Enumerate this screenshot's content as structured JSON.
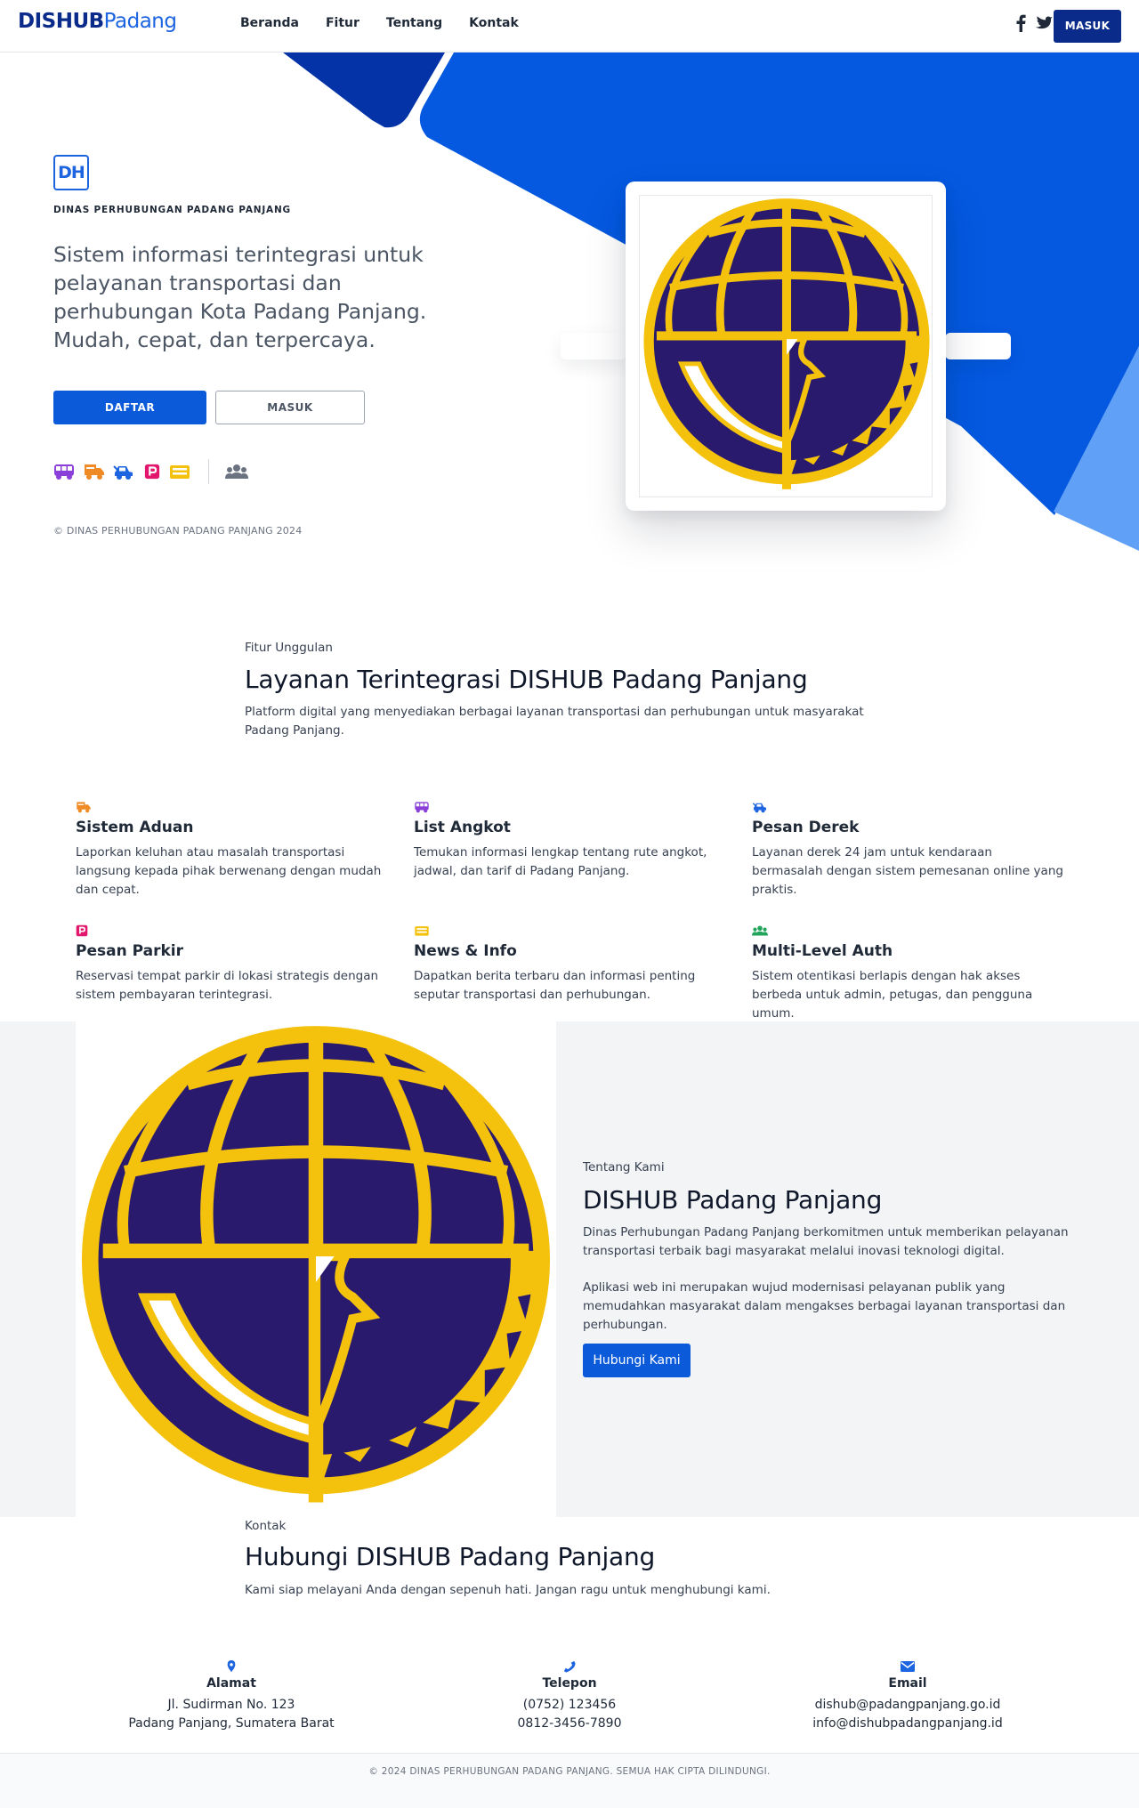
{
  "nav": {
    "brand_bold": "DISHUB",
    "brand_light": "Padang",
    "links": [
      "Beranda",
      "Fitur",
      "Tentang",
      "Kontak"
    ],
    "login_label": "MASUK"
  },
  "hero": {
    "badge": "DH",
    "org_name": "DINAS PERHUBUNGAN PADANG PANJANG",
    "description": "Sistem informasi terintegrasi untuk pelayanan transportasi dan perhubungan Kota Padang Panjang. Mudah, cepat, dan terpercaya.",
    "register_label": "DAFTAR",
    "login_label": "MASUK",
    "copyright": "© DINAS PERHUBUNGAN PADANG PANJANG 2024",
    "icons": [
      "bus-icon",
      "truck-icon",
      "tow-car-icon",
      "parking-icon",
      "news-icon",
      "users-icon"
    ]
  },
  "colors": {
    "navy": "#0b2b8a",
    "blue": "#0b5ad9",
    "shape_blue": "#0459e0",
    "light_blue": "#60a0f7",
    "logo_purple": "#2a1a6e",
    "logo_gold": "#f4c20d"
  },
  "features": {
    "label": "Fitur Unggulan",
    "title": "Layanan Terintegrasi DISHUB Padang Panjang",
    "subtitle": "Platform digital yang menyediakan berbagai layanan transportasi dan perhubungan untuk masyarakat Padang Panjang.",
    "items": [
      {
        "icon": "truck-icon",
        "title": "Sistem Aduan",
        "desc": "Laporkan keluhan atau masalah transportasi langsung kepada pihak berwenang dengan mudah dan cepat."
      },
      {
        "icon": "bus-icon",
        "title": "List Angkot",
        "desc": "Temukan informasi lengkap tentang rute angkot, jadwal, dan tarif di Padang Panjang."
      },
      {
        "icon": "tow-car-icon",
        "title": "Pesan Derek",
        "desc": "Layanan derek 24 jam untuk kendaraan bermasalah dengan sistem pemesanan online yang praktis."
      },
      {
        "icon": "parking-icon",
        "title": "Pesan Parkir",
        "desc": "Reservasi tempat parkir di lokasi strategis dengan sistem pembayaran terintegrasi."
      },
      {
        "icon": "news-icon",
        "title": "News & Info",
        "desc": "Dapatkan berita terbaru dan informasi penting seputar transportasi dan perhubungan."
      },
      {
        "icon": "users-icon",
        "title": "Multi-Level Auth",
        "desc": "Sistem otentikasi berlapis dengan hak akses berbeda untuk admin, petugas, dan pengguna umum."
      }
    ]
  },
  "about": {
    "label": "Tentang Kami",
    "title": "DISHUB Padang Panjang",
    "p1": "Dinas Perhubungan Padang Panjang berkomitmen untuk memberikan pelayanan transportasi terbaik bagi masyarakat melalui inovasi teknologi digital.",
    "p2": "Aplikasi web ini merupakan wujud modernisasi pelayanan publik yang memudahkan masyarakat dalam mengakses berbagai layanan transportasi dan perhubungan.",
    "button": "Hubungi Kami"
  },
  "contact": {
    "label": "Kontak",
    "title": "Hubungi DISHUB Padang Panjang",
    "subtitle": "Kami siap melayani Anda dengan sepenuh hati. Jangan ragu untuk menghubungi kami.",
    "columns": [
      {
        "icon": "map-pin-icon",
        "title": "Alamat",
        "lines": [
          "Jl. Sudirman No. 123",
          "Padang Panjang, Sumatera Barat"
        ]
      },
      {
        "icon": "phone-icon",
        "title": "Telepon",
        "lines": [
          "(0752) 123456",
          "0812-3456-7890"
        ]
      },
      {
        "icon": "envelope-icon",
        "title": "Email",
        "lines": [
          "dishub@padangpanjang.go.id",
          "info@dishubpadangpanjang.id"
        ]
      }
    ]
  },
  "footer": {
    "text": "© 2024 DINAS PERHUBUNGAN PADANG PANJANG. SEMUA HAK CIPTA DILINDUNGI."
  }
}
